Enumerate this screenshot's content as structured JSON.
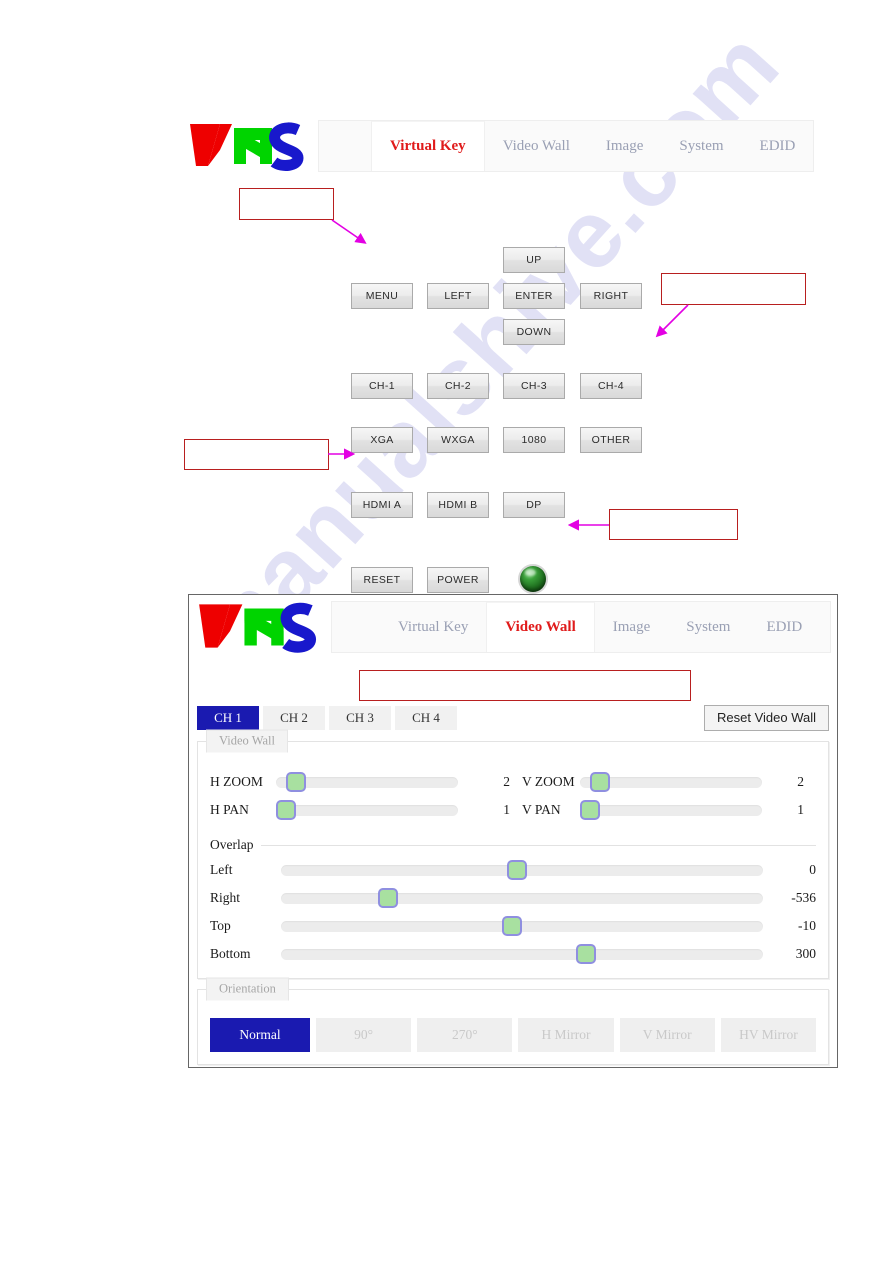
{
  "logo": {
    "alt": "VNS",
    "letters": [
      "V",
      "N",
      "S"
    ],
    "colors": [
      "#ee0000",
      "#00d400",
      "#1818cc"
    ]
  },
  "panel1": {
    "name": "Virtual Key panel",
    "nav": {
      "tabs": [
        {
          "label": "Virtual Key",
          "active": true
        },
        {
          "label": "Video Wall",
          "active": false
        },
        {
          "label": "Image",
          "active": false
        },
        {
          "label": "System",
          "active": false
        },
        {
          "label": "EDID",
          "active": false
        }
      ]
    },
    "buttons": {
      "menu": "MENU",
      "left": "LEFT",
      "up": "UP",
      "enter": "ENTER",
      "right": "RIGHT",
      "down": "DOWN",
      "ch1": "CH-1",
      "ch2": "CH-2",
      "ch3": "CH-3",
      "ch4": "CH-4",
      "xga": "XGA",
      "wxga": "WXGA",
      "p1080": "1080",
      "other": "OTHER",
      "hdmia": "HDMI A",
      "hdmib": "HDMI B",
      "dp": "DP",
      "reset": "RESET",
      "power": "POWER"
    },
    "led": {
      "label": "",
      "color": "#2e8b2e"
    },
    "callouts": [
      {
        "id": "callout-menu",
        "text": ""
      },
      {
        "id": "callout-ch4",
        "text": ""
      },
      {
        "id": "callout-hdmia",
        "text": ""
      },
      {
        "id": "callout-led",
        "text": ""
      }
    ]
  },
  "panel2": {
    "name": "Video Wall panel",
    "nav": {
      "tabs": [
        {
          "label": "Virtual Key",
          "active": false
        },
        {
          "label": "Video Wall",
          "active": true
        },
        {
          "label": "Image",
          "active": false
        },
        {
          "label": "System",
          "active": false
        },
        {
          "label": "EDID",
          "active": false
        }
      ]
    },
    "callouts": [
      {
        "id": "callout-videowall-top",
        "text": ""
      }
    ],
    "channel_tabs": [
      {
        "label": "CH 1",
        "active": true
      },
      {
        "label": "CH 2",
        "active": false
      },
      {
        "label": "CH 3",
        "active": false
      },
      {
        "label": "CH 4",
        "active": false
      }
    ],
    "reset_button": "Reset Video Wall",
    "videowall_group": {
      "legend": "Video Wall",
      "zoom_pan": [
        {
          "label": "H ZOOM",
          "value": "2",
          "pos_pct": 6
        },
        {
          "label": "V ZOOM",
          "value": "2",
          "pos_pct": 6
        },
        {
          "label": "H PAN",
          "value": "1",
          "pos_pct": 0
        },
        {
          "label": "V PAN",
          "value": "1",
          "pos_pct": 0
        }
      ],
      "overlap_label": "Overlap",
      "overlap": [
        {
          "label": "Left",
          "value": "0",
          "pos_pct": 49
        },
        {
          "label": "Right",
          "value": "-536",
          "pos_pct": 21
        },
        {
          "label": "Top",
          "value": "-10",
          "pos_pct": 48
        },
        {
          "label": "Bottom",
          "value": "300",
          "pos_pct": 64
        }
      ]
    },
    "orientation_group": {
      "legend": "Orientation",
      "buttons": [
        {
          "label": "Normal",
          "active": true
        },
        {
          "label": "90°",
          "active": false
        },
        {
          "label": "270°",
          "active": false
        },
        {
          "label": "H Mirror",
          "active": false
        },
        {
          "label": "V Mirror",
          "active": false
        },
        {
          "label": "HV Mirror",
          "active": false
        }
      ]
    }
  },
  "watermark": {
    "text": "manualshive.com"
  }
}
